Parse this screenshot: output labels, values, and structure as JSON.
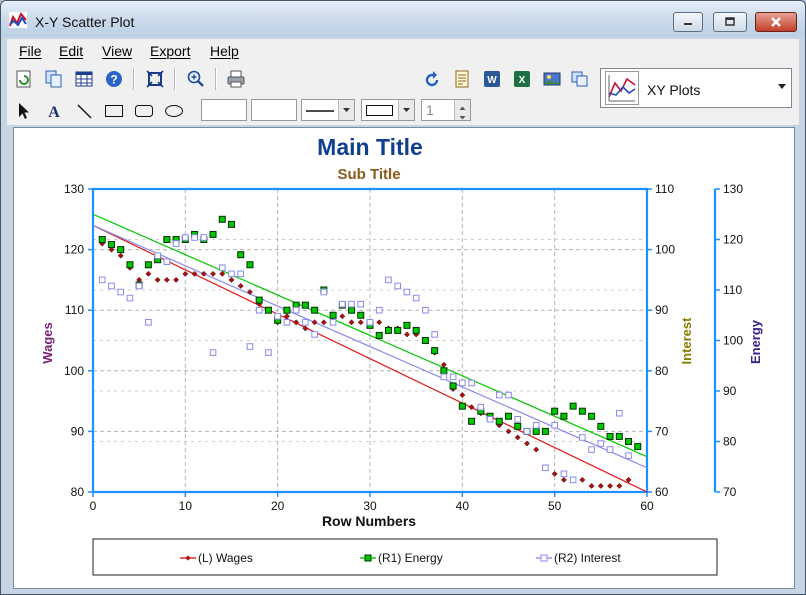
{
  "window": {
    "title": "X-Y Scatter Plot"
  },
  "menu": [
    "File",
    "Edit",
    "View",
    "Export",
    "Help"
  ],
  "plot_selector": {
    "value": "XY Plots"
  },
  "toolbar2": {
    "spin_value": "1"
  },
  "colors": {
    "wages": "#c81414",
    "energy": "#00c800",
    "interest": "#8a8aee",
    "axis": "#1e90ff",
    "title": "#103f8f",
    "subtitle": "#8b5a1e"
  },
  "chart_data": {
    "type": "scatter",
    "title": "Main Title",
    "subtitle": "Sub Title",
    "xlabel": "Row Numbers",
    "xlim": [
      0,
      60
    ],
    "xticks": [
      "0",
      "10",
      "20",
      "30",
      "40",
      "50",
      "60"
    ],
    "y_left": {
      "label": "Wages",
      "lim": [
        80,
        130
      ],
      "ticks": [
        "80",
        "90",
        "100",
        "110",
        "120",
        "130"
      ]
    },
    "y_right1": {
      "label": "Interest",
      "lim": [
        60,
        110
      ],
      "ticks": [
        "60",
        "70",
        "80",
        "90",
        "100",
        "110"
      ]
    },
    "y_right2": {
      "label": "Energy",
      "lim": [
        70,
        130
      ],
      "ticks": [
        "70",
        "80",
        "90",
        "100",
        "110",
        "120",
        "130"
      ]
    },
    "grid": true,
    "legend_position": "bottom",
    "series": [
      {
        "name": "(L) Wages",
        "axis": "left",
        "color": "#c81414",
        "points": [
          [
            1,
            121
          ],
          [
            2,
            120
          ],
          [
            3,
            119
          ],
          [
            4,
            117
          ],
          [
            5,
            115
          ],
          [
            6,
            116
          ],
          [
            7,
            115
          ],
          [
            8,
            115
          ],
          [
            9,
            115
          ],
          [
            10,
            116
          ],
          [
            11,
            116
          ],
          [
            12,
            116
          ],
          [
            13,
            116
          ],
          [
            14,
            116
          ],
          [
            15,
            115
          ],
          [
            16,
            114
          ],
          [
            17,
            113
          ],
          [
            18,
            111
          ],
          [
            19,
            110
          ],
          [
            20,
            108
          ],
          [
            21,
            109
          ],
          [
            22,
            108
          ],
          [
            23,
            107
          ],
          [
            24,
            108
          ],
          [
            25,
            108
          ],
          [
            26,
            108
          ],
          [
            27,
            109
          ],
          [
            28,
            108
          ],
          [
            29,
            108
          ],
          [
            30,
            108
          ],
          [
            31,
            108
          ],
          [
            32,
            107
          ],
          [
            33,
            107
          ],
          [
            34,
            106
          ],
          [
            35,
            106
          ],
          [
            36,
            105
          ],
          [
            37,
            103
          ],
          [
            38,
            101
          ],
          [
            39,
            97
          ],
          [
            40,
            96
          ],
          [
            41,
            94
          ],
          [
            42,
            93
          ],
          [
            43,
            92
          ],
          [
            44,
            91
          ],
          [
            45,
            90
          ],
          [
            46,
            89
          ],
          [
            47,
            88
          ],
          [
            48,
            87
          ],
          [
            49,
            84
          ],
          [
            50,
            83
          ],
          [
            51,
            82
          ],
          [
            52,
            82
          ],
          [
            53,
            82
          ],
          [
            54,
            81
          ],
          [
            55,
            81
          ],
          [
            56,
            81
          ],
          [
            57,
            81
          ],
          [
            58,
            82
          ]
        ],
        "trend": [
          [
            0,
            124
          ],
          [
            60,
            80
          ]
        ]
      },
      {
        "name": "(R1) Energy",
        "axis": "right2",
        "color": "#00a000",
        "points": [
          [
            1,
            120
          ],
          [
            2,
            119
          ],
          [
            3,
            118
          ],
          [
            4,
            115
          ],
          [
            5,
            111
          ],
          [
            6,
            115
          ],
          [
            7,
            116
          ],
          [
            8,
            120
          ],
          [
            9,
            120
          ],
          [
            10,
            120
          ],
          [
            11,
            121
          ],
          [
            12,
            120
          ],
          [
            13,
            121
          ],
          [
            14,
            124
          ],
          [
            15,
            123
          ],
          [
            16,
            117
          ],
          [
            17,
            115
          ],
          [
            18,
            108
          ],
          [
            19,
            106
          ],
          [
            20,
            104
          ],
          [
            21,
            106
          ],
          [
            22,
            107
          ],
          [
            23,
            107
          ],
          [
            24,
            106
          ],
          [
            25,
            110
          ],
          [
            26,
            105
          ],
          [
            27,
            107
          ],
          [
            28,
            106
          ],
          [
            29,
            105
          ],
          [
            30,
            103
          ],
          [
            31,
            101
          ],
          [
            32,
            102
          ],
          [
            33,
            102
          ],
          [
            34,
            103
          ],
          [
            35,
            102
          ],
          [
            36,
            100
          ],
          [
            37,
            98
          ],
          [
            38,
            94
          ],
          [
            39,
            91
          ],
          [
            40,
            87
          ],
          [
            41,
            84
          ],
          [
            42,
            86
          ],
          [
            43,
            85
          ],
          [
            44,
            84
          ],
          [
            45,
            85
          ],
          [
            46,
            83
          ],
          [
            47,
            82
          ],
          [
            48,
            82
          ],
          [
            49,
            82
          ],
          [
            50,
            86
          ],
          [
            51,
            85
          ],
          [
            52,
            87
          ],
          [
            53,
            86
          ],
          [
            54,
            85
          ],
          [
            55,
            83
          ],
          [
            56,
            81
          ],
          [
            57,
            81
          ],
          [
            58,
            80
          ],
          [
            59,
            79
          ]
        ],
        "trend": [
          [
            0,
            125
          ],
          [
            60,
            77
          ]
        ]
      },
      {
        "name": "(R2) Interest",
        "axis": "right1",
        "color": "#8a8aee",
        "points": [
          [
            1,
            95
          ],
          [
            2,
            94
          ],
          [
            3,
            93
          ],
          [
            4,
            92
          ],
          [
            5,
            94
          ],
          [
            6,
            88
          ],
          [
            7,
            99
          ],
          [
            8,
            98
          ],
          [
            9,
            101
          ],
          [
            10,
            102
          ],
          [
            11,
            102
          ],
          [
            12,
            102
          ],
          [
            13,
            83
          ],
          [
            14,
            97
          ],
          [
            15,
            96
          ],
          [
            16,
            96
          ],
          [
            17,
            84
          ],
          [
            18,
            90
          ],
          [
            19,
            83
          ],
          [
            20,
            89
          ],
          [
            21,
            88
          ],
          [
            22,
            90
          ],
          [
            23,
            88
          ],
          [
            24,
            86
          ],
          [
            25,
            93
          ],
          [
            26,
            88
          ],
          [
            27,
            91
          ],
          [
            28,
            91
          ],
          [
            29,
            91
          ],
          [
            30,
            88
          ],
          [
            31,
            90
          ],
          [
            32,
            95
          ],
          [
            33,
            94
          ],
          [
            34,
            93
          ],
          [
            35,
            92
          ],
          [
            36,
            90
          ],
          [
            37,
            86
          ],
          [
            38,
            79
          ],
          [
            39,
            79
          ],
          [
            40,
            78
          ],
          [
            41,
            78
          ],
          [
            42,
            74
          ],
          [
            43,
            72
          ],
          [
            44,
            76
          ],
          [
            45,
            76
          ],
          [
            46,
            72
          ],
          [
            47,
            70
          ],
          [
            48,
            71
          ],
          [
            49,
            64
          ],
          [
            50,
            71
          ],
          [
            51,
            63
          ],
          [
            52,
            62
          ],
          [
            53,
            69
          ],
          [
            54,
            67
          ],
          [
            55,
            68
          ],
          [
            56,
            67
          ],
          [
            57,
            73
          ],
          [
            58,
            66
          ]
        ],
        "trend": [
          [
            0,
            104
          ],
          [
            60,
            64
          ]
        ]
      }
    ]
  }
}
